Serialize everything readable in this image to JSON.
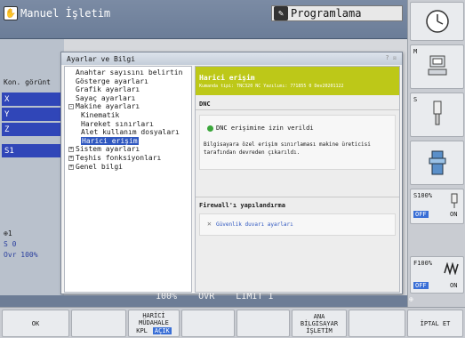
{
  "header": {
    "mode_manual": "Manuel İşletim",
    "mode_programming": "Programlama"
  },
  "left_panel": {
    "label": "Kon. görünt",
    "axes": [
      "X",
      "Y",
      "Z",
      "S1"
    ],
    "feed_label": "1",
    "s_label": "S 0",
    "override_label": "Ovr 100%"
  },
  "dialog": {
    "title": "Ayarlar ve Bilgi",
    "tree": [
      {
        "label": "Anahtar sayısını belirtin",
        "level": 1,
        "expander": ""
      },
      {
        "label": "Gösterge ayarları",
        "level": 1,
        "expander": ""
      },
      {
        "label": "Grafik ayarları",
        "level": 1,
        "expander": ""
      },
      {
        "label": "Sayaç ayarları",
        "level": 1,
        "expander": ""
      },
      {
        "label": "Makine ayarları",
        "level": 0,
        "expander": "-"
      },
      {
        "label": "Kinematik",
        "level": 2,
        "expander": ""
      },
      {
        "label": "Hareket sınırları",
        "level": 2,
        "expander": ""
      },
      {
        "label": "Alet kullanım dosyaları",
        "level": 2,
        "expander": ""
      },
      {
        "label": "Harici erişim",
        "level": 2,
        "expander": "",
        "selected": true
      },
      {
        "label": "Sistem ayarları",
        "level": 0,
        "expander": "+"
      },
      {
        "label": "Teşhis fonksiyonları",
        "level": 0,
        "expander": "+"
      },
      {
        "label": "Genel bilgi",
        "level": 0,
        "expander": "+"
      }
    ],
    "content": {
      "header_title": "Harici erişim",
      "header_meta": "Kumanda tipi: TNC320       NC Yazılımı: 771855 0 Dev20201122",
      "dnc_heading": "DNC",
      "dnc_status": "DNC erişimine izin verildi",
      "dnc_note": "Bilgisayara özel erişim sınırlaması makine üreticisi tarafından devreden çıkarıldı.",
      "firewall_heading": "Firewall'ı yapılandırma",
      "firewall_link": "Güvenlik duvarı ayarları"
    }
  },
  "bottom_strip": {
    "text": "100%    OVR    LIMIT 1"
  },
  "right_softkeys": {
    "s100_label": "S100%",
    "f100_label": "F100%",
    "off_label": "OFF",
    "on_label": "ON",
    "m_label": "M",
    "s_label": "S"
  },
  "softkeys": {
    "ok": "OK",
    "external_line1": "HARİCİ",
    "external_line2": "MÜDAHALE",
    "kpl": "KPL",
    "acik": "AÇIK",
    "host_line1": "ANA",
    "host_line2": "BİLGİSAYAR",
    "host_line3": "İŞLETİM",
    "cancel": "İPTAL ET"
  },
  "colors": {
    "header_green": "#bdc818",
    "axis_blue": "#3046b8",
    "status_green": "#3aa63a"
  }
}
